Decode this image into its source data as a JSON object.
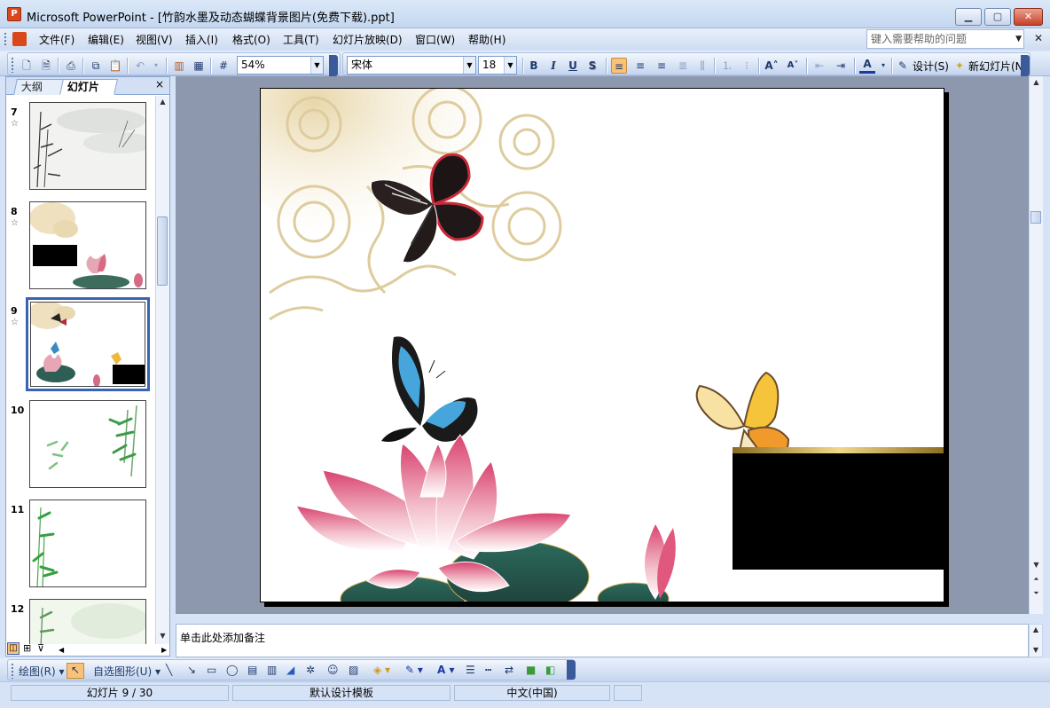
{
  "window": {
    "title": "Microsoft PowerPoint - [竹韵水墨及动态蝴蝶背景图片(免费下载).ppt]",
    "app_icon_letter": "P"
  },
  "menu": {
    "items": [
      "文件(F)",
      "编辑(E)",
      "视图(V)",
      "插入(I)",
      "格式(O)",
      "工具(T)",
      "幻灯片放映(D)",
      "窗口(W)",
      "帮助(H)"
    ],
    "help_placeholder": "键入需要帮助的问题"
  },
  "toolbar": {
    "zoom": "54%",
    "font_name": "宋体",
    "font_size": "18",
    "bold": "B",
    "italic": "I",
    "underline": "U",
    "shadow": "S",
    "design_label": "设计(S)",
    "new_slide_label": "新幻灯片(N)"
  },
  "panel": {
    "tab_outline": "大纲",
    "tab_slides": "幻灯片",
    "close": "×",
    "thumbnails": [
      {
        "number": "7"
      },
      {
        "number": "8"
      },
      {
        "number": "9"
      },
      {
        "number": "10"
      },
      {
        "number": "11"
      },
      {
        "number": "12"
      }
    ],
    "selected": "9"
  },
  "notes": {
    "placeholder": "单击此处添加备注"
  },
  "drawing": {
    "draw_label": "绘图(R)",
    "autoshapes_label": "自选图形(U)"
  },
  "status": {
    "slide": "幻灯片 9 / 30",
    "template": "默认设计模板",
    "language": "中文(中国)"
  },
  "colors": {
    "accent": "#3a63b3",
    "slide_box": "#000000",
    "gold_line": "#c6a24a",
    "workspace": "#8d98ae"
  }
}
